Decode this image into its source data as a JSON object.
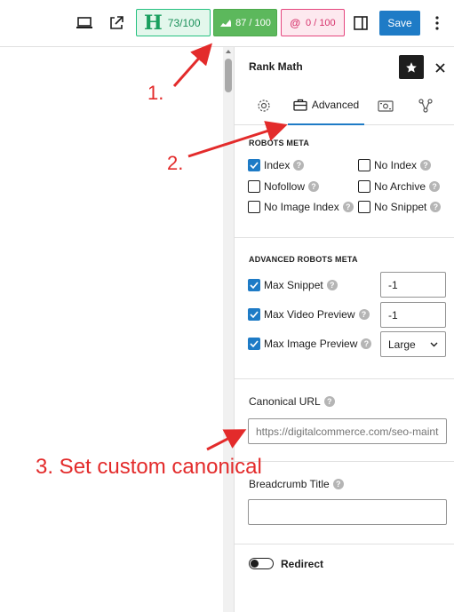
{
  "toolbar": {
    "hemingway_score": "73/100",
    "hemingway_letter": "H",
    "rankmath_score": "87 / 100",
    "content_ai_score": "0 / 100",
    "content_ai_symbol": "@",
    "save_label": "Save"
  },
  "panel": {
    "title": "Rank Math",
    "tabs": [
      {
        "name": "general",
        "label": ""
      },
      {
        "name": "advanced",
        "label": "Advanced"
      },
      {
        "name": "social",
        "label": ""
      },
      {
        "name": "schema",
        "label": ""
      }
    ]
  },
  "robots_meta": {
    "title": "ROBOTS META",
    "options": [
      {
        "label": "Index",
        "checked": true
      },
      {
        "label": "No Index",
        "checked": false
      },
      {
        "label": "Nofollow",
        "checked": false
      },
      {
        "label": "No Archive",
        "checked": false
      },
      {
        "label": "No Image Index",
        "checked": false
      },
      {
        "label": "No Snippet",
        "checked": false
      }
    ]
  },
  "advanced_robots": {
    "title": "ADVANCED ROBOTS META",
    "rows": [
      {
        "label": "Max Snippet",
        "checked": true,
        "value": "-1"
      },
      {
        "label": "Max Video Preview",
        "checked": true,
        "value": "-1"
      },
      {
        "label": "Max Image Preview",
        "checked": true,
        "value": "Large"
      }
    ]
  },
  "canonical": {
    "label": "Canonical URL",
    "placeholder": "https://digitalcommerce.com/seo-maint"
  },
  "breadcrumb": {
    "label": "Breadcrumb Title",
    "value": ""
  },
  "redirect": {
    "label": "Redirect",
    "enabled": false
  },
  "annotations": {
    "step1": "1.",
    "step2": "2.",
    "step3": "3. Set custom canonical"
  },
  "colors": {
    "accent": "#1e7bc6",
    "annotation": "#e32b2b",
    "rankmath_green": "#5cb85c"
  }
}
